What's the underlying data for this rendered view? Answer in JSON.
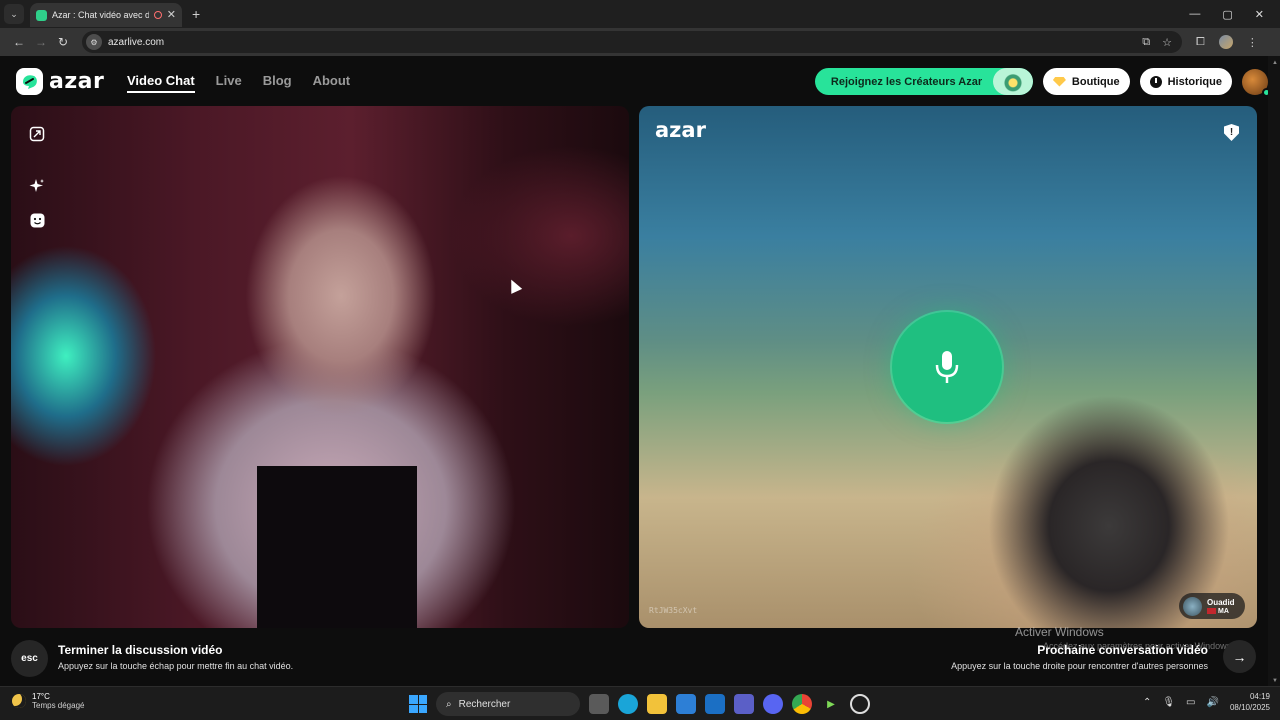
{
  "browser": {
    "tab_title": "Azar : Chat vidéo avec de n",
    "new_tab": "+",
    "url": "azarlive.com",
    "window_controls": [
      "—",
      "▢",
      "✕"
    ]
  },
  "header": {
    "logo": "azar",
    "nav": [
      {
        "label": "Video Chat",
        "active": true
      },
      {
        "label": "Live",
        "active": false
      },
      {
        "label": "Blog",
        "active": false
      },
      {
        "label": "About",
        "active": false
      }
    ],
    "creators_label": "Rejoignez les Créateurs Azar",
    "shop_label": "Boutique",
    "history_label": "Historique"
  },
  "left_video": {
    "tools": [
      "expand-icon",
      "sparkle-icon",
      "face-filter-icon"
    ]
  },
  "right_video": {
    "logo": "azar",
    "user_code": "RtJW35cXvt",
    "peer": {
      "name": "Ouadid",
      "country": "MA"
    }
  },
  "footer": {
    "esc_key": "esc",
    "end_title": "Terminer la discussion vidéo",
    "end_hint": "Appuyez sur la touche échap pour mettre fin au chat vidéo.",
    "next_title": "Prochaine conversation vidéo",
    "next_hint": "Appuyez sur la touche droite pour rencontrer d'autres personnes",
    "watermark_title": "Activer Windows",
    "watermark_sub": "Accédez aux paramètres pour activer Windows."
  },
  "taskbar": {
    "temp": "17°C",
    "weather": "Temps dégagé",
    "search_placeholder": "Rechercher",
    "time": "04:19",
    "date": "08/10/2025"
  },
  "colors": {
    "accent": "#28e39a",
    "mic_button": "#1fbf80",
    "background": "#0d0d0d"
  }
}
